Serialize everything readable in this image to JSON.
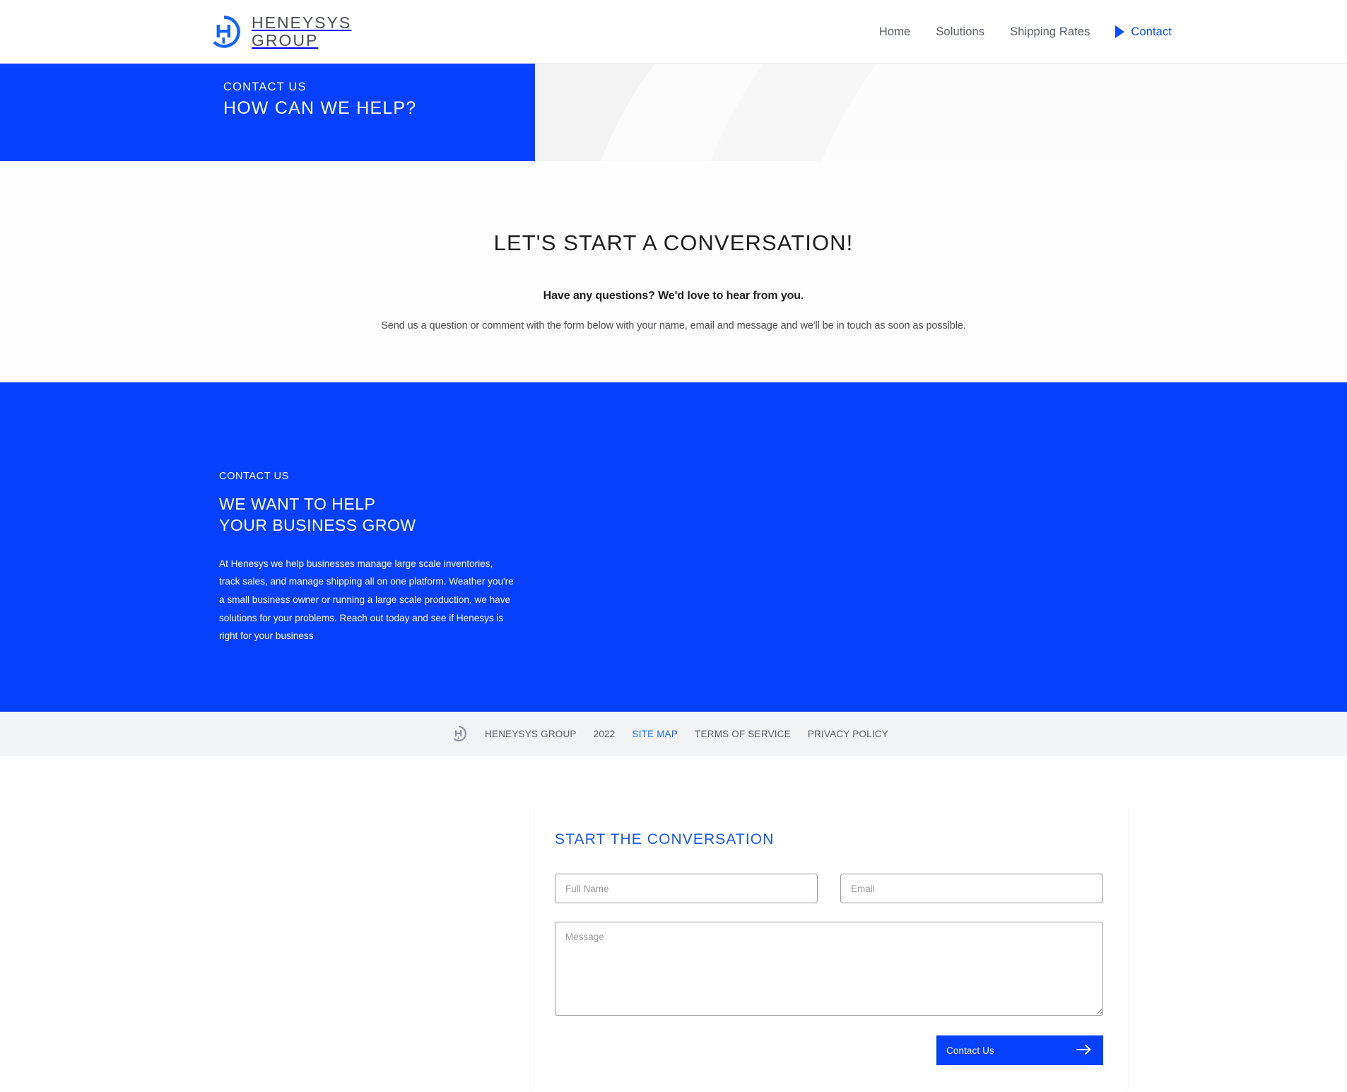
{
  "colors": {
    "brand_blue": "#0540fc",
    "link_blue": "#1658f0",
    "hero_bg": "#f3f3f3",
    "footer_bg": "#f2f3f4",
    "text_dark": "#1d1d1f",
    "text_muted": "#585e66"
  },
  "header": {
    "logo_icon": "heneysys-circle-h-icon",
    "brand_line1": "HENEYSYS",
    "brand_line2": "GROUP",
    "nav": [
      {
        "label": "Home",
        "active": false
      },
      {
        "label": "Solutions",
        "active": false
      },
      {
        "label": "Shipping Rates",
        "active": false
      },
      {
        "label": "Contact",
        "active": true
      }
    ],
    "active_marker_icon": "play-triangle-icon"
  },
  "hero": {
    "eyebrow": "CONTACT US",
    "title": "HOW CAN WE HELP?"
  },
  "intro": {
    "title": "LET'S START A CONVERSATION!",
    "lead": "Have any questions? We'd love to hear from you.",
    "body": "Send us a question or comment with the form below with your name, email and message and we'll be in touch as soon as possible."
  },
  "contact": {
    "eyebrow": "CONTACT US",
    "title_line1": "WE WANT TO HELP",
    "title_line2": "YOUR BUSINESS GROW",
    "body": "At Henesys we help businesses manage large scale inventories, track sales, and manage shipping all on one platform. Weather you're a small business owner or running a large scale production, we have solutions for your problems. Reach out today and see if Henesys is right for your business"
  },
  "form": {
    "title": "START THE CONVERSATION",
    "fields": {
      "full_name": {
        "placeholder": "Full Name",
        "value": ""
      },
      "email": {
        "placeholder": "Email",
        "value": ""
      },
      "message": {
        "placeholder": "Message",
        "value": ""
      }
    },
    "submit_label": "Contact Us",
    "submit_icon": "arrow-right-icon"
  },
  "footer": {
    "logo_icon": "heneysys-circle-h-icon",
    "company": "HENEYSYS GROUP",
    "year": "2022",
    "links": [
      {
        "label": "SITE MAP",
        "accent": true
      },
      {
        "label": "TERMS OF SERVICE",
        "accent": false
      },
      {
        "label": "PRIVACY POLICY",
        "accent": false
      }
    ]
  }
}
